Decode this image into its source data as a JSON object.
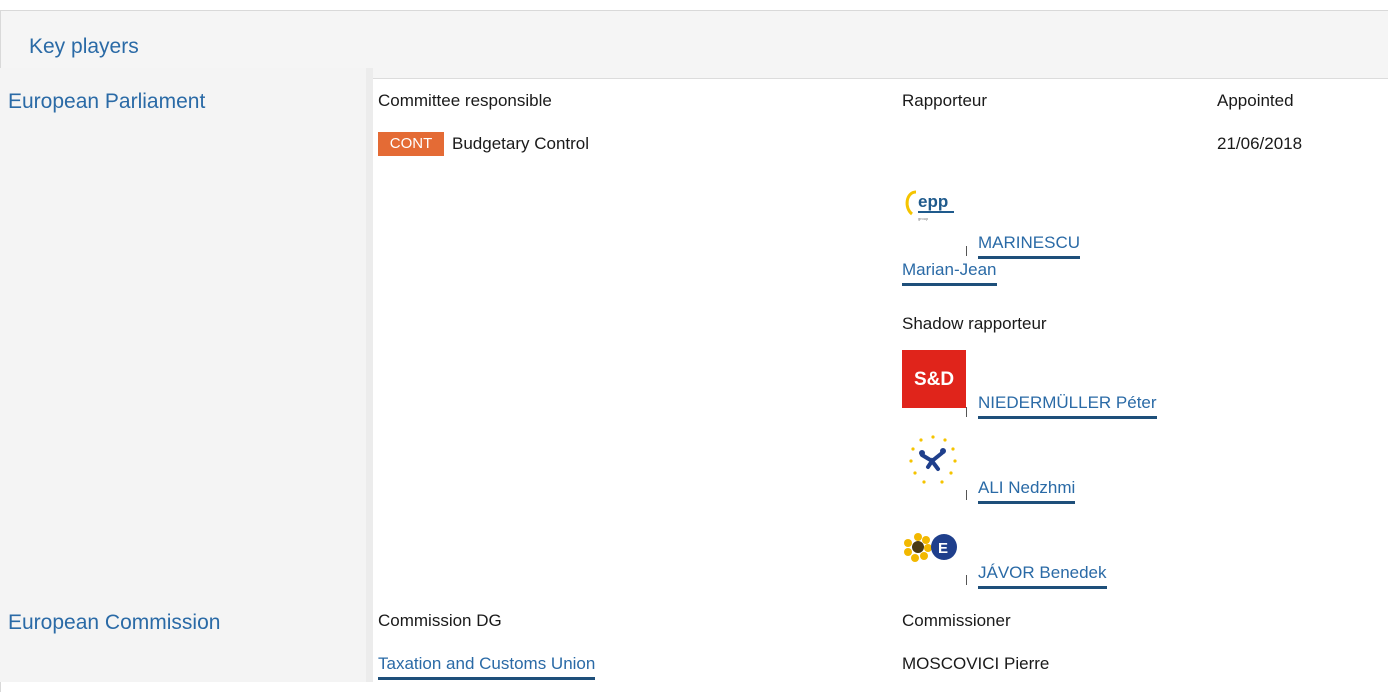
{
  "panel": {
    "title": "Key players"
  },
  "parliament": {
    "label": "European Parliament",
    "col_committee": "Committee responsible",
    "col_rapporteur": "Rapporteur",
    "col_appointed": "Appointed",
    "committee_badge": "CONT",
    "committee_name": "Budgetary Control",
    "appointed_date": "21/06/2018",
    "rapporteur": {
      "group_logo": "epp-logo",
      "name_line1": "MARINESCU",
      "name_line2": "Marian-Jean"
    },
    "shadow_label": "Shadow rapporteur",
    "shadows": [
      {
        "group_logo": "sd-logo",
        "logo_text": "S&D",
        "name": "NIEDERMÜLLER Péter"
      },
      {
        "group_logo": "alde-logo",
        "name": "ALI Nedzhmi"
      },
      {
        "group_logo": "greens-efa-logo",
        "name": "JÁVOR Benedek"
      }
    ]
  },
  "commission": {
    "label": "European Commission",
    "col_dg": "Commission DG",
    "col_commissioner": "Commissioner",
    "dg_name": "Taxation and Customs Union",
    "commissioner_name": "MOSCOVICI Pierre"
  },
  "colors": {
    "link": "#2a6aa6",
    "link_underline": "#1e4f7a",
    "badge": "#e46b35",
    "sd_red": "#e0241b"
  }
}
